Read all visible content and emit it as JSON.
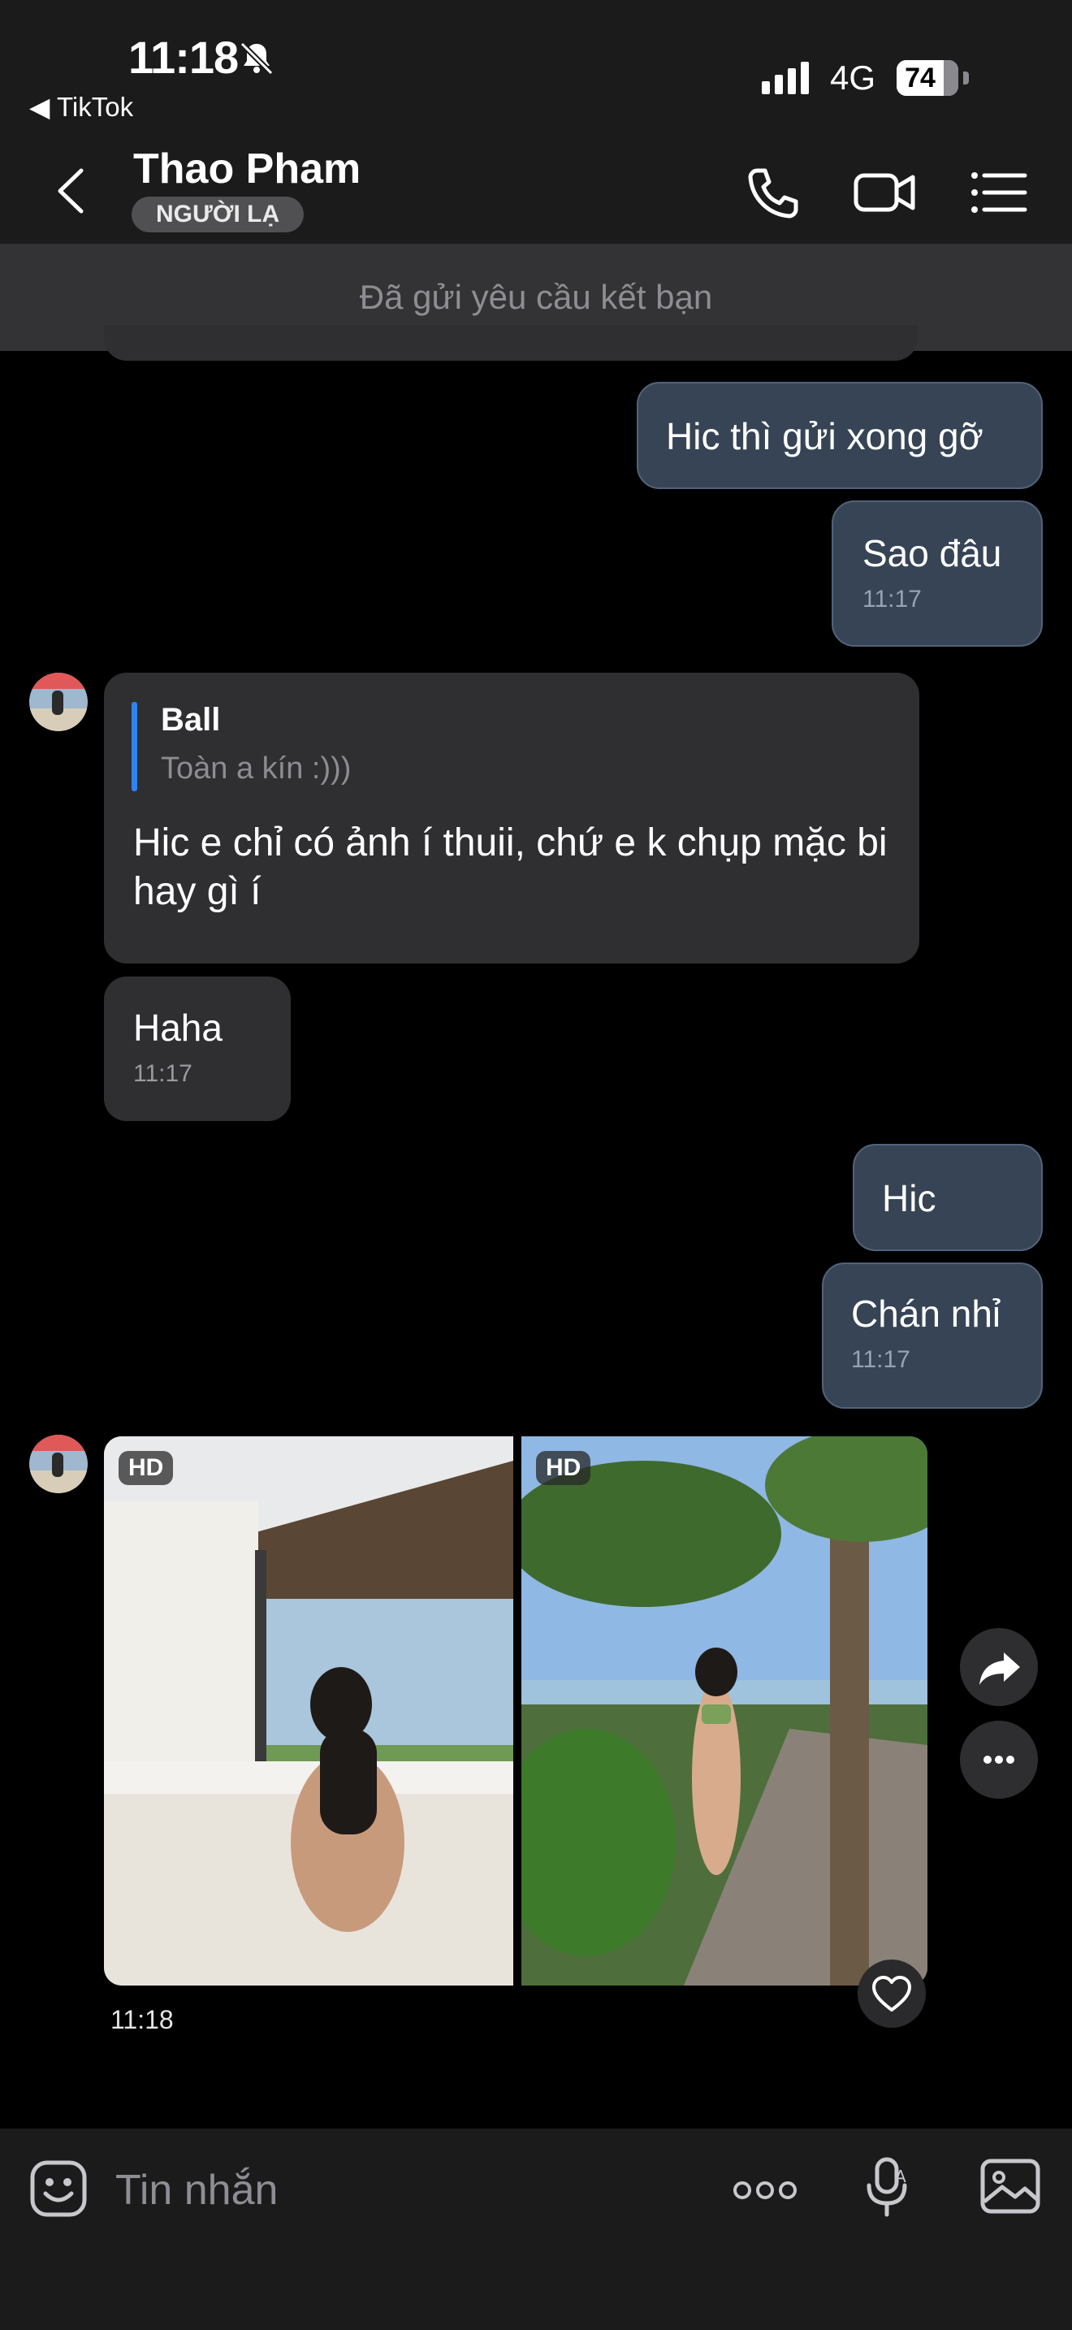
{
  "status_bar": {
    "time": "11:18",
    "back_app": "◀ TikTok",
    "network": "4G",
    "battery": "74",
    "battery_level": 0.74
  },
  "header": {
    "title": "Thao Pham",
    "badge": "NGƯỜI LẠ"
  },
  "friend_request_text": "Đã gửi yêu cầu kết bạn",
  "messages": {
    "m1": {
      "text": "Hic thì gửi xong gỡ"
    },
    "m2": {
      "text": "Sao đâu",
      "time": "11:17"
    },
    "m3": {
      "quote_author": "Ball",
      "quote_text": "Toàn a kín :)))",
      "text": "Hic e chỉ có ảnh í thuii, chứ e k chụp mặc bi hay gì í"
    },
    "m4": {
      "text": "Haha",
      "time": "11:17"
    },
    "m5": {
      "text": "Hic"
    },
    "m6": {
      "text": "Chán nhỉ",
      "time": "11:17"
    },
    "photos": {
      "badge_left": "HD",
      "badge_right": "HD",
      "time": "11:18"
    }
  },
  "composer": {
    "placeholder": "Tin nhắn"
  },
  "colors": {
    "outgoing_bubble": "#364455",
    "incoming_bubble": "#2f2f32",
    "quote_accent": "#2f84ef"
  }
}
